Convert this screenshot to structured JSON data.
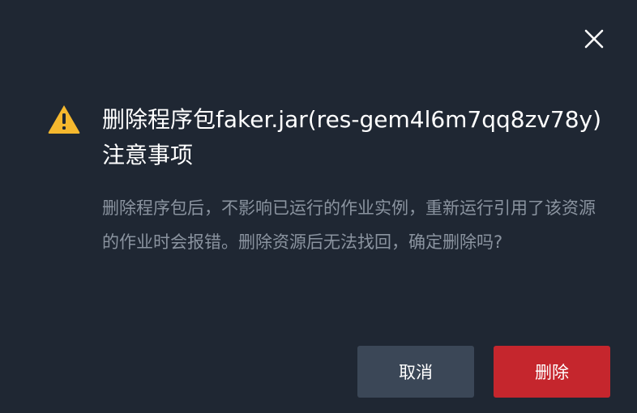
{
  "dialog": {
    "title": "删除程序包faker.jar(res-gem4l6m7qq8zv78y)注意事项",
    "message": "删除程序包后，不影响已运行的作业实例，重新运行引用了该资源的作业时会报错。删除资源后无法找回，确定删除吗?",
    "cancel_label": "取消",
    "delete_label": "删除",
    "icons": {
      "close": "close-icon",
      "warning": "warning-icon"
    },
    "colors": {
      "background": "#1f2733",
      "warning": "#f5b82e",
      "delete_button": "#c5262d",
      "cancel_button": "#3b4757"
    }
  }
}
